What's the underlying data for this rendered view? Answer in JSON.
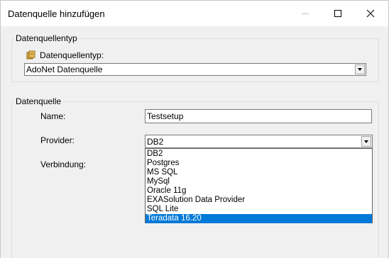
{
  "window": {
    "title": "Datenquelle hinzufügen"
  },
  "group_type": {
    "legend": "Datenquellentyp",
    "label": "Datenquellentyp:",
    "selected_value": "AdoNet Datenquelle"
  },
  "group_source": {
    "legend": "Datenquelle",
    "name_label": "Name:",
    "name_value": "Testsetup",
    "provider_label": "Provider:",
    "provider_value": "DB2",
    "connection_label": "Verbindung:"
  },
  "provider_options": [
    "DB2",
    "Postgres",
    "MS SQL",
    "MySql",
    "Oracle 11g",
    "EXASolution Data Provider",
    "SQL Lite",
    "Teradata 16.20"
  ],
  "highlighted_option": "Teradata 16.20",
  "colors": {
    "selection": "#0078d7",
    "group_border": "#d5dfe5"
  },
  "icons": [
    "minimize-icon",
    "maximize-icon",
    "close-icon",
    "database-icon",
    "chevron-down-icon"
  ]
}
